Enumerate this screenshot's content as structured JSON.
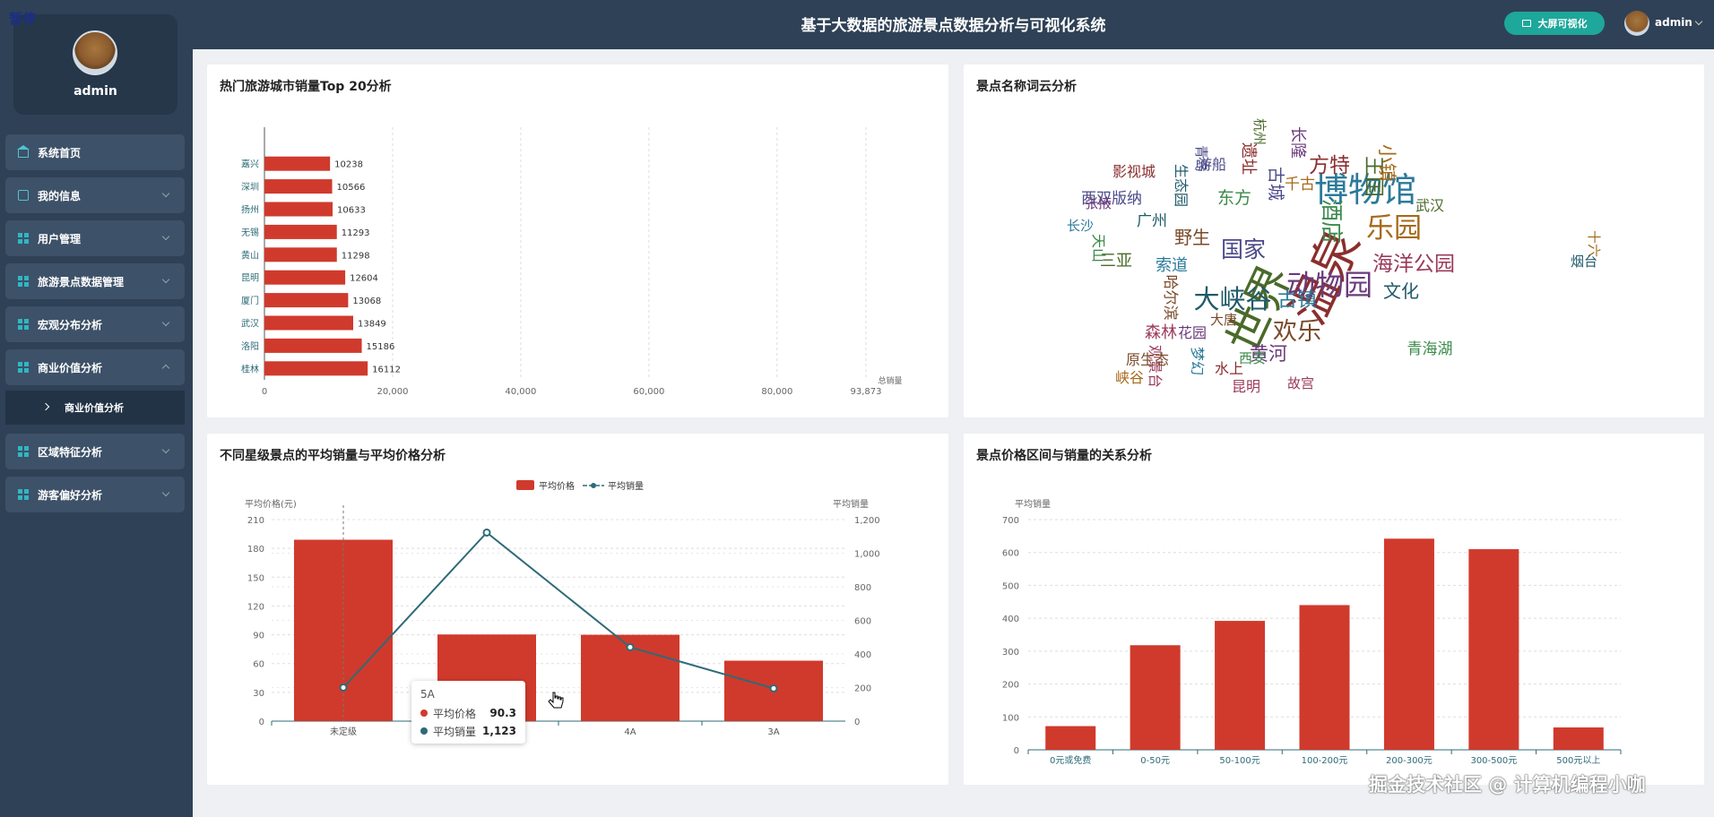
{
  "app": {
    "title": "基于大数据的旅游景点数据分析与可视化系统",
    "pause_badge": "暂停"
  },
  "header": {
    "bigscreen_label": "大屏可视化",
    "user": "admin"
  },
  "sidebar": {
    "profile_name": "admin",
    "items": [
      {
        "label": "系统首页",
        "icon": "home-icon"
      },
      {
        "label": "我的信息",
        "icon": "id-card-icon"
      },
      {
        "label": "用户管理",
        "icon": "grid-icon"
      },
      {
        "label": "旅游景点数据管理",
        "icon": "grid-icon"
      },
      {
        "label": "宏观分布分析",
        "icon": "grid-icon"
      },
      {
        "label": "商业价值分析",
        "icon": "grid-icon",
        "expanded": true
      },
      {
        "label": "区域特征分析",
        "icon": "grid-icon"
      },
      {
        "label": "游客偏好分析",
        "icon": "grid-icon"
      }
    ],
    "subitem": "商业价值分析"
  },
  "panels": {
    "p1": {
      "title": "热门旅游城市销量Top 20分析"
    },
    "p2": {
      "title": "景点名称词云分析"
    },
    "p3": {
      "title": "不同星级景点的平均销量与平均价格分析"
    },
    "p4": {
      "title": "景点价格区间与销量的关系分析"
    }
  },
  "tooltip": {
    "title": "5A",
    "rows": [
      {
        "label": "平均价格",
        "value": "90.3",
        "color": "#d03a2c"
      },
      {
        "label": "平均销量",
        "value": "1,123",
        "color": "#2e6b77"
      }
    ]
  },
  "watermark": "掘金技术社区 @ 计算机编程小咖",
  "colors": {
    "bar": "#d03a2c",
    "line": "#2e6b77",
    "accent": "#1ea79b",
    "sidebar": "#2f4156"
  },
  "chart_data": [
    {
      "type": "bar",
      "orientation": "horizontal",
      "categories": [
        "嘉兴",
        "深圳",
        "扬州",
        "无锡",
        "黄山",
        "昆明",
        "厦门",
        "武汉",
        "洛阳",
        "桂林"
      ],
      "values": [
        10238,
        10566,
        10633,
        11293,
        11298,
        12604,
        13068,
        13849,
        15186,
        16112
      ],
      "value_labels": [
        "10238",
        "10566",
        "10633",
        "11293",
        "11298",
        "12604",
        "13068",
        "13849",
        "15186",
        "16112"
      ],
      "x_ticks": [
        "0",
        "20,000",
        "40,000",
        "60,000",
        "80,000"
      ],
      "x_max_label": "93,873",
      "xlim": [
        0,
        93873
      ],
      "xlabel": "总销量"
    },
    {
      "type": "wordcloud",
      "words": [
        {
          "text": "温泉",
          "w": 5
        },
        {
          "text": "世界",
          "w": 4.5
        },
        {
          "text": "博物馆",
          "w": 3.2
        },
        {
          "text": "动物园",
          "w": 2.6
        },
        {
          "text": "乐园",
          "w": 2.4
        },
        {
          "text": "大峡谷",
          "w": 2.2
        },
        {
          "text": "欢乐",
          "w": 2
        },
        {
          "text": "国家",
          "w": 1.8
        },
        {
          "text": "酒店",
          "w": 1.8
        },
        {
          "text": "海洋公园",
          "w": 1.6
        },
        {
          "text": "方特",
          "w": 1.5
        },
        {
          "text": "王国",
          "w": 1.5
        },
        {
          "text": "古镇",
          "w": 1.4
        },
        {
          "text": "黄河",
          "w": 1.3
        },
        {
          "text": "小镇",
          "w": 1.3
        },
        {
          "text": "文化",
          "w": 1.2
        },
        {
          "text": "野生",
          "w": 1.2
        },
        {
          "text": "古城",
          "w": 1.1
        },
        {
          "text": "东方",
          "w": 1.1
        },
        {
          "text": "森林",
          "w": 1
        },
        {
          "text": "遗址",
          "w": 1
        },
        {
          "text": "三亚",
          "w": 1
        },
        {
          "text": "索道",
          "w": 1
        },
        {
          "text": "长隆",
          "w": 1
        },
        {
          "text": "千古",
          "w": 0.9
        },
        {
          "text": "广州",
          "w": 0.9
        },
        {
          "text": "哈尔滨",
          "w": 0.9
        },
        {
          "text": "西双版纳",
          "w": 0.9
        },
        {
          "text": "青海湖",
          "w": 0.9
        },
        {
          "text": "观景台",
          "w": 0.8
        },
        {
          "text": "水上",
          "w": 0.8
        },
        {
          "text": "武汉",
          "w": 0.8
        },
        {
          "text": "梦幻",
          "w": 0.8
        },
        {
          "text": "花园",
          "w": 0.8
        },
        {
          "text": "峡谷",
          "w": 0.8
        },
        {
          "text": "生态园",
          "w": 0.8
        },
        {
          "text": "原生态",
          "w": 0.8
        },
        {
          "text": "游船",
          "w": 0.8
        },
        {
          "text": "天山",
          "w": 0.8
        },
        {
          "text": "昆明",
          "w": 0.8
        },
        {
          "text": "影视城",
          "w": 0.8
        },
        {
          "text": "杭州",
          "w": 0.7
        },
        {
          "text": "长沙",
          "w": 0.7
        },
        {
          "text": "张掖",
          "w": 0.7
        },
        {
          "text": "十六",
          "w": 0.7
        },
        {
          "text": "烟台",
          "w": 0.7
        },
        {
          "text": "大唐",
          "w": 0.7
        },
        {
          "text": "青岛",
          "w": 0.7
        },
        {
          "text": "西安",
          "w": 0.7
        },
        {
          "text": "故宫",
          "w": 0.7
        }
      ]
    },
    {
      "type": "bar+line",
      "categories": [
        "未定级",
        "5A",
        "4A",
        "3A"
      ],
      "series": [
        {
          "name": "平均价格",
          "type": "bar",
          "axis": "left",
          "values": [
            189,
            90.3,
            90,
            63
          ]
        },
        {
          "name": "平均销量",
          "type": "line",
          "axis": "right",
          "values": [
            200,
            1123,
            440,
            195
          ]
        }
      ],
      "ylabel_left": "平均价格(元)",
      "ylabel_right": "平均销量",
      "yticks_left": [
        "0",
        "30",
        "60",
        "90",
        "120",
        "150",
        "180",
        "210"
      ],
      "yticks_right": [
        "0",
        "200",
        "400",
        "600",
        "800",
        "1,000",
        "1,200"
      ],
      "ylim_left": [
        0,
        210
      ],
      "ylim_right": [
        0,
        1200
      ]
    },
    {
      "type": "bar",
      "categories": [
        "0元或免费",
        "0-50元",
        "50-100元",
        "100-200元",
        "200-300元",
        "300-500元",
        "500元以上"
      ],
      "values": [
        72,
        318,
        392,
        440,
        642,
        610,
        68
      ],
      "ylabel": "平均销量",
      "yticks": [
        "0",
        "100",
        "200",
        "300",
        "400",
        "500",
        "600",
        "700"
      ],
      "ylim": [
        0,
        700
      ]
    }
  ]
}
